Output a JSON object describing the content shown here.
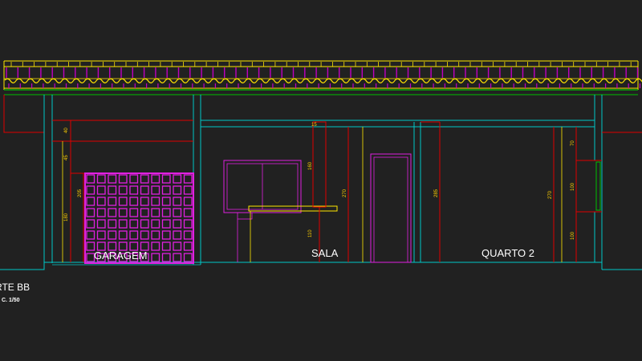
{
  "drawing": {
    "title": "RTE BB",
    "scale": "C. 1/50",
    "rooms": {
      "garage": "GARAGEM",
      "living": "SALA",
      "bedroom": "QUARTO 2"
    },
    "dimensions": {
      "garage_top": "40",
      "garage_mid": "45",
      "garage_window": "205",
      "garage_low": "180",
      "sala_top": "15",
      "sala_window": "160",
      "sala_total": "270",
      "sala_low": "110",
      "quarto_left": "285",
      "quarto_right": "270",
      "right_top": "70",
      "right_mid": "100",
      "right_low": "100"
    },
    "colors": {
      "background": "#212121",
      "wall": "#00c8c8",
      "roof": "#ffe600",
      "roof_tile": "#c000c0",
      "dimension": "#e00000",
      "grid": "#e020e0",
      "text": "#ffffff",
      "green": "#00c000"
    }
  }
}
